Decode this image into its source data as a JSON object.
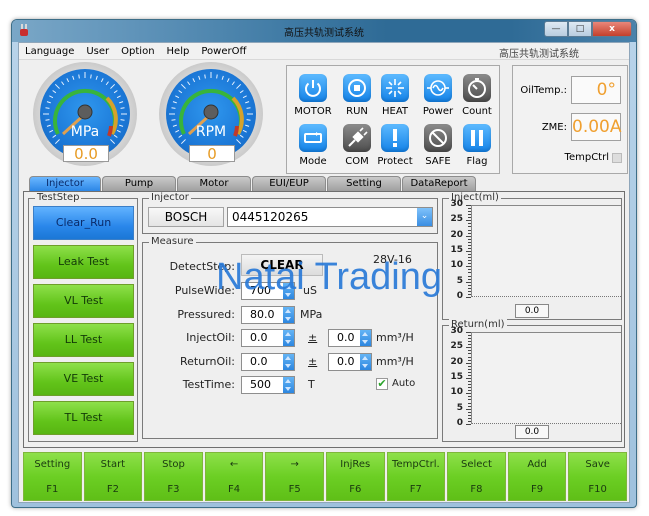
{
  "window": {
    "title": "高压共轨测试系统",
    "controls": {
      "minimize": "—",
      "maximize": "□",
      "close": "x"
    }
  },
  "menubar": {
    "items": [
      "Language",
      "User",
      "Option",
      "Help",
      "PowerOff"
    ],
    "right_title": "高压共轨测试系统"
  },
  "gauges": [
    {
      "unit": "MPa",
      "value": "0.0"
    },
    {
      "unit": "RPM",
      "value": "0"
    }
  ],
  "status_icons": [
    {
      "label": "MOTOR",
      "icon": "power-icon",
      "style": "blue"
    },
    {
      "label": "RUN",
      "icon": "stop-square-icon",
      "style": "blue"
    },
    {
      "label": "HEAT",
      "icon": "sunburst-icon",
      "style": "blue"
    },
    {
      "label": "Power",
      "icon": "sine-wave-icon",
      "style": "blue"
    },
    {
      "label": "Count",
      "icon": "timer-icon",
      "style": "gray"
    },
    {
      "label": "Mode",
      "icon": "loop-icon",
      "style": "blue"
    },
    {
      "label": "COM",
      "icon": "plug-icon",
      "style": "gray"
    },
    {
      "label": "Protect",
      "icon": "exclamation-icon",
      "style": "blue"
    },
    {
      "label": "SAFE",
      "icon": "prohibited-icon",
      "style": "gray"
    },
    {
      "label": "Flag",
      "icon": "pause-icon",
      "style": "blue"
    }
  ],
  "temp_panel": {
    "oil_temp_label": "OilTemp.:",
    "oil_temp_value": "0°",
    "zme_label": "ZME:",
    "zme_value": "0.00A",
    "tempctrl_label": "TempCtrl",
    "tempctrl_checked": true
  },
  "tabs": [
    {
      "label": "Injector",
      "active": true
    },
    {
      "label": "Pump",
      "active": false
    },
    {
      "label": "Motor",
      "active": false
    },
    {
      "label": "EUI/EUP",
      "active": false
    },
    {
      "label": "Setting",
      "active": false
    },
    {
      "label": "DataReport",
      "active": false
    }
  ],
  "teststep": {
    "legend": "TestStep",
    "buttons": [
      {
        "label": "Clear_Run",
        "active": true
      },
      {
        "label": "Leak Test",
        "active": false
      },
      {
        "label": "VL Test",
        "active": false
      },
      {
        "label": "LL Test",
        "active": false
      },
      {
        "label": "VE Test",
        "active": false
      },
      {
        "label": "TL Test",
        "active": false
      }
    ]
  },
  "injector": {
    "legend": "Injector",
    "brand": "BOSCH",
    "model": "0445120265"
  },
  "measure": {
    "legend": "Measure",
    "detect_step_label": "DetectStep:",
    "detect_step_value": "CLEAR",
    "code": "28V-16",
    "pulsewide_label": "PulseWide:",
    "pulsewide_value": "700",
    "pulsewide_unit": "uS",
    "pressured_label": "Pressured:",
    "pressured_value": "80.0",
    "pressured_unit": "MPa",
    "injectoil_label": "InjectOil:",
    "injectoil_value": "0.0",
    "injectoil_tol": "0.0",
    "returnoil_label": "ReturnOil:",
    "returnoil_value": "0.0",
    "returnoil_tol": "0.0",
    "pm": "±",
    "flow_unit": "mm³/H",
    "testtime_label": "TestTime:",
    "testtime_value": "500",
    "testtime_unit": "T",
    "auto_label": "Auto",
    "auto_checked": true
  },
  "inject_chart": {
    "legend": "Inject(ml)",
    "ticks": [
      "30",
      "25",
      "20",
      "15",
      "10",
      "5",
      "0"
    ],
    "value": "0.0"
  },
  "return_chart": {
    "legend": "Return(ml)",
    "ticks": [
      "30",
      "25",
      "20",
      "15",
      "10",
      "5",
      "0"
    ],
    "value": "0.0"
  },
  "fkeys": [
    {
      "label": "Setting",
      "key": "F1"
    },
    {
      "label": "Start",
      "key": "F2"
    },
    {
      "label": "Stop",
      "key": "F3"
    },
    {
      "label": "←",
      "key": "F4"
    },
    {
      "label": "→",
      "key": "F5"
    },
    {
      "label": "InjRes",
      "key": "F6"
    },
    {
      "label": "TempCtrl.",
      "key": "F7"
    },
    {
      "label": "Select",
      "key": "F8"
    },
    {
      "label": "Add",
      "key": "F9"
    },
    {
      "label": "Save",
      "key": "F10"
    }
  ],
  "watermark": "Natai Trading",
  "colors": {
    "accent_blue": "#2a87ea",
    "step_green": "#62c41a",
    "readout_orange": "#e79b24"
  }
}
